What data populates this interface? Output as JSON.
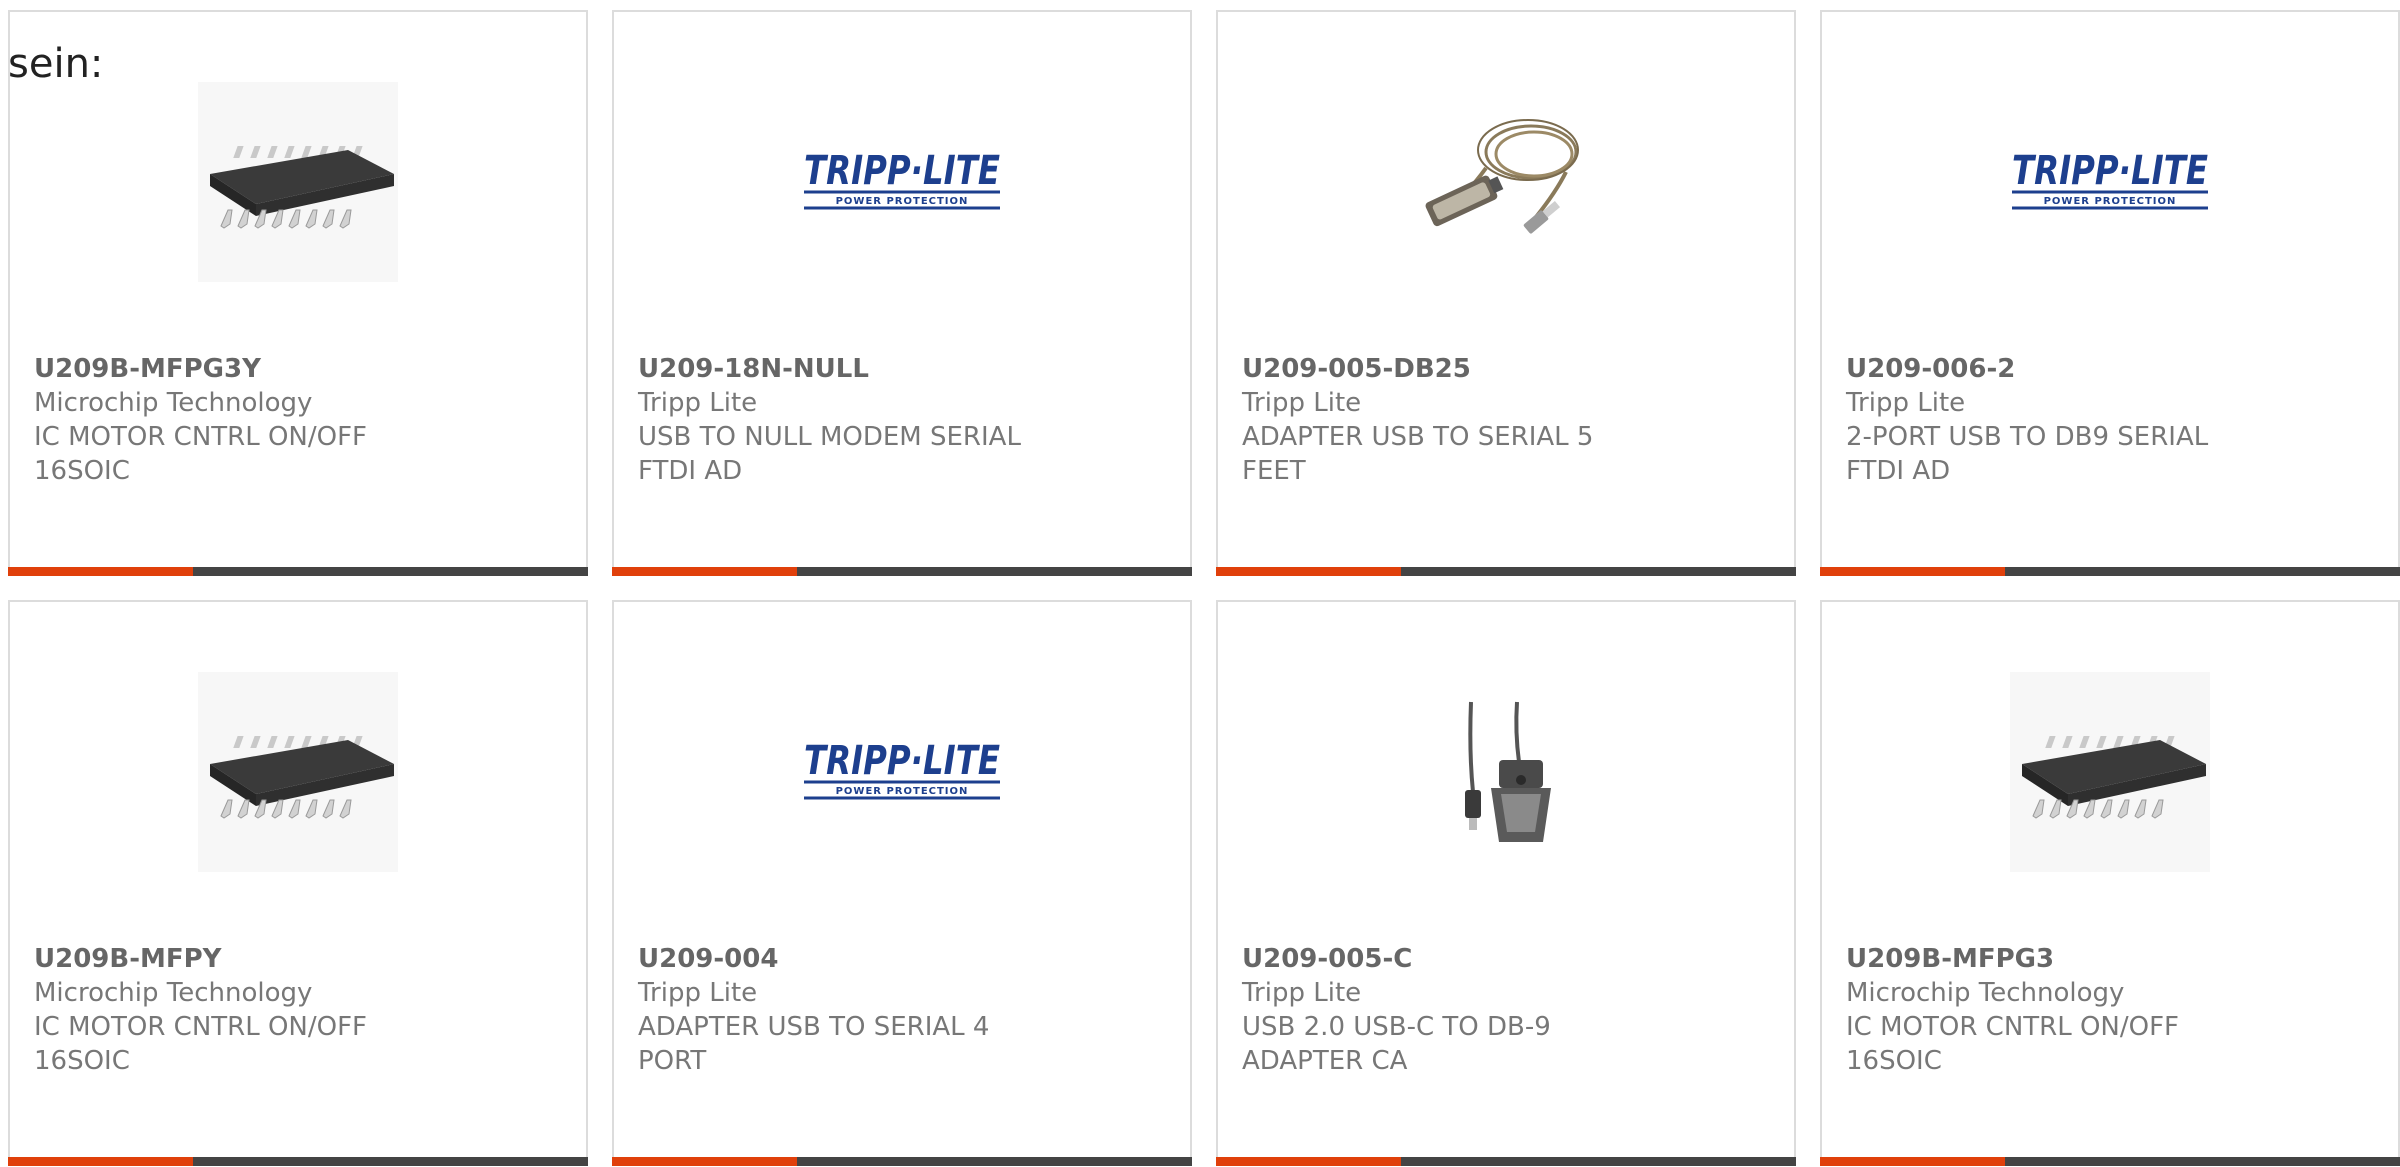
{
  "intro_text": "sein:",
  "colors": {
    "accent": "#e0400b",
    "bar_dark": "#444444",
    "card_border": "#dcdcdc",
    "text": "#777777",
    "logo_blue": "#1d3f8e"
  },
  "products": [
    {
      "part": "U209B-MFPG3Y",
      "manufacturer": "Microchip Technology",
      "description": "IC MOTOR CNTRL ON/OFF 16SOIC",
      "image": "soic-chip-icon"
    },
    {
      "part": "U209-18N-NULL",
      "manufacturer": "Tripp Lite",
      "description": "USB TO NULL MODEM SERIAL FTDI AD",
      "image": "tripp-lite-logo"
    },
    {
      "part": "U209-005-DB25",
      "manufacturer": "Tripp Lite",
      "description": "ADAPTER USB TO SERIAL 5 FEET",
      "image": "db25-usb-cable-icon"
    },
    {
      "part": "U209-006-2",
      "manufacturer": "Tripp Lite",
      "description": "2-PORT USB TO DB9 SERIAL FTDI AD",
      "image": "tripp-lite-logo"
    },
    {
      "part": "U209B-MFPY",
      "manufacturer": "Microchip Technology",
      "description": "IC MOTOR CNTRL ON/OFF 16SOIC",
      "image": "soic-chip-icon"
    },
    {
      "part": "U209-004",
      "manufacturer": "Tripp Lite",
      "description": "ADAPTER USB TO SERIAL 4 PORT",
      "image": "tripp-lite-logo"
    },
    {
      "part": "U209-005-C",
      "manufacturer": "Tripp Lite",
      "description": "USB 2.0 USB-C TO DB-9 ADAPTER CA",
      "image": "usbc-db9-adapter-icon"
    },
    {
      "part": "U209B-MFPG3",
      "manufacturer": "Microchip Technology",
      "description": "IC MOTOR CNTRL ON/OFF 16SOIC",
      "image": "soic-chip-icon"
    }
  ],
  "logo_text": {
    "brand": "TRIPP·LITE",
    "tagline": "POWER PROTECTION"
  }
}
